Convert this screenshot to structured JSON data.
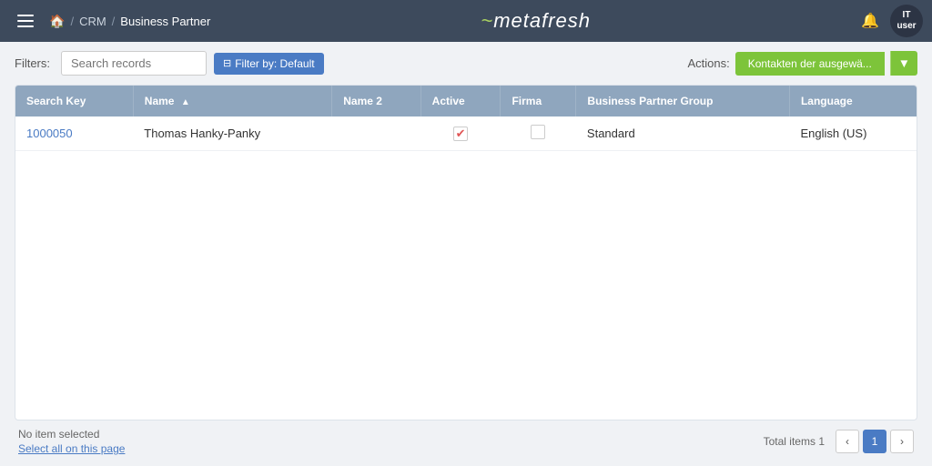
{
  "navbar": {
    "menu_icon": "menu-icon",
    "breadcrumb": {
      "home": "🏠",
      "sep1": "/",
      "crm": "CRM",
      "sep2": "/",
      "current": "Business Partner"
    },
    "logo": "metafresh",
    "logo_prefix": "~",
    "bell_icon": "🔔",
    "user": {
      "initials": "IT\nuser",
      "label": "IT user"
    }
  },
  "filters": {
    "label": "Filters:",
    "search_placeholder": "Search records",
    "filter_button": "Filter by: Default",
    "actions_label": "Actions:",
    "actions_button": "Kontakten der ausgewä...",
    "dropdown_arrow": "▼"
  },
  "table": {
    "columns": [
      {
        "key": "search_key",
        "label": "Search Key",
        "sortable": false
      },
      {
        "key": "name",
        "label": "Name",
        "sortable": true
      },
      {
        "key": "name2",
        "label": "Name 2",
        "sortable": false
      },
      {
        "key": "active",
        "label": "Active",
        "sortable": false
      },
      {
        "key": "firma",
        "label": "Firma",
        "sortable": false
      },
      {
        "key": "business_partner_group",
        "label": "Business Partner Group",
        "sortable": false
      },
      {
        "key": "language",
        "label": "Language",
        "sortable": false
      }
    ],
    "rows": [
      {
        "search_key": "1000050",
        "name": "Thomas Hanky-Panky",
        "name2": "",
        "active": true,
        "firma": false,
        "business_partner_group": "Standard",
        "language": "English (US)"
      }
    ]
  },
  "footer": {
    "no_item_selected": "No item selected",
    "select_all": "Select all on this page",
    "total_items_label": "Total items",
    "total_items": "1",
    "current_page": "1",
    "prev_arrow": "‹",
    "next_arrow": "›"
  }
}
